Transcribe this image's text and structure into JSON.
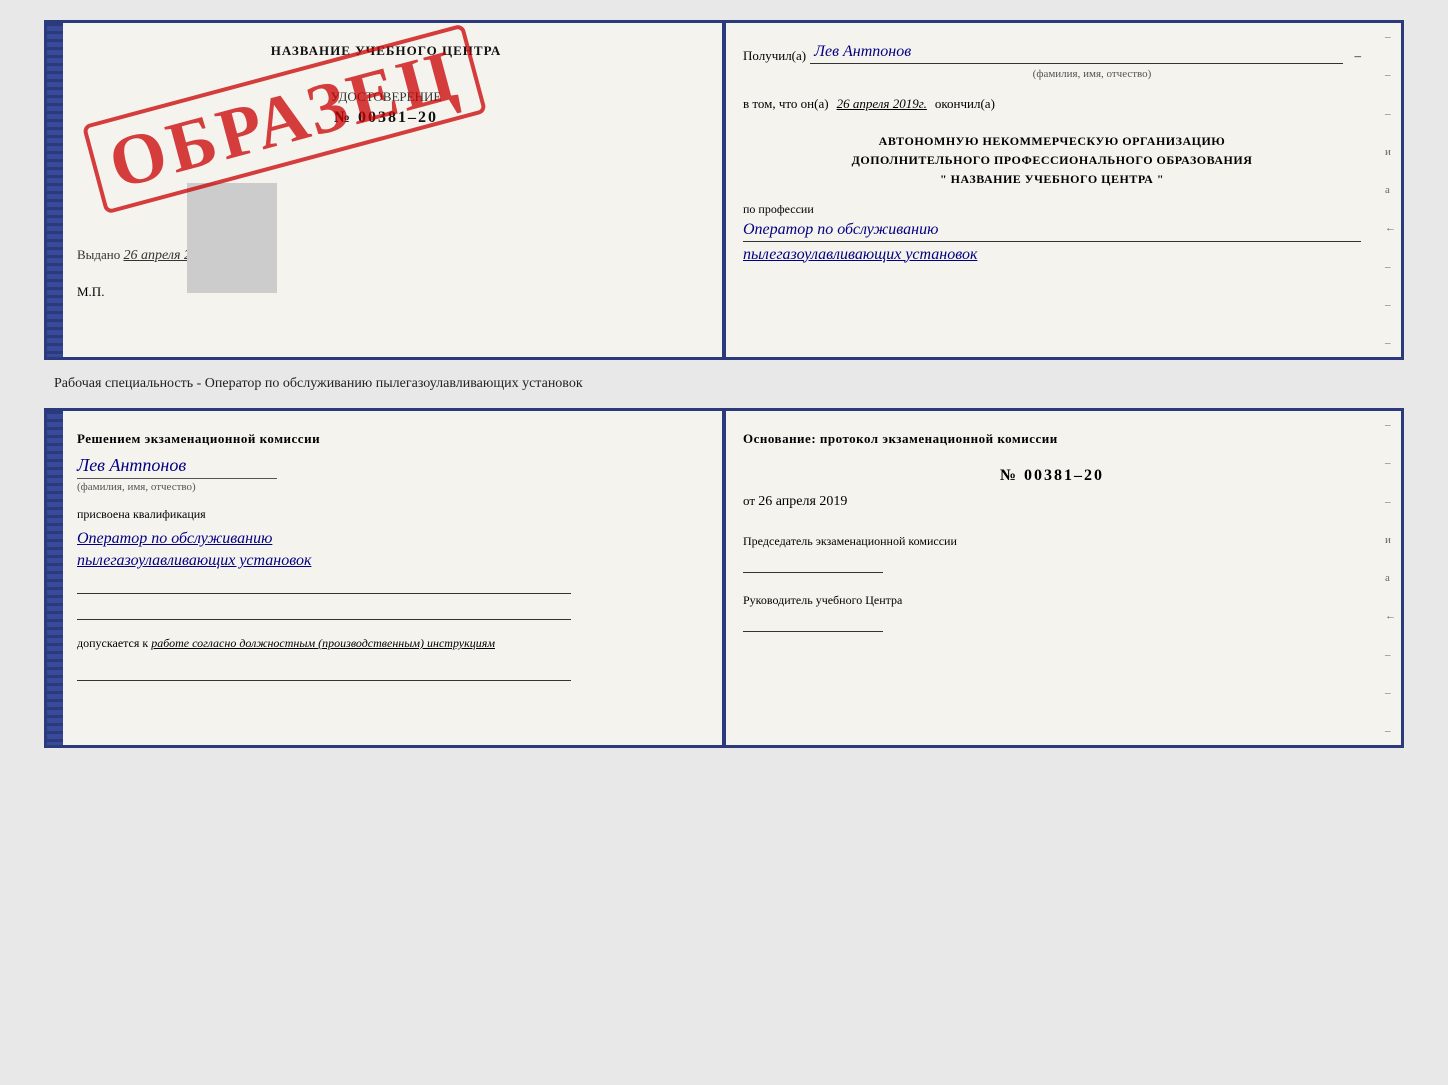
{
  "page": {
    "background": "#e8e8e8"
  },
  "top_cert": {
    "left": {
      "title": "НАЗВАНИЕ УЧЕБНОГО ЦЕНТРА",
      "stamp": "ОБРАЗЕЦ",
      "doc_label": "УДОСТОВЕРЕНИЕ",
      "doc_number_prefix": "№",
      "doc_number": "00381–20",
      "issued_label": "Выдано",
      "issued_date": "26 апреля 2019",
      "mp_label": "М.П."
    },
    "right": {
      "received_label": "Получил(а)",
      "received_name": "Лев Антпонов",
      "fio_subtitle": "(фамилия, имя, отчество)",
      "in_that_label": "в том, что он(а)",
      "in_that_date": "26 апреля 2019г.",
      "completed_label": "окончил(а)",
      "org_line1": "АВТОНОМНУЮ НЕКОММЕРЧЕСКУЮ ОРГАНИЗАЦИЮ",
      "org_line2": "ДОПОЛНИТЕЛЬНОГО ПРОФЕССИОНАЛЬНОГО ОБРАЗОВАНИЯ",
      "org_name_open": "\"",
      "org_name": "НАЗВАНИЕ УЧЕБНОГО ЦЕНТРА",
      "org_name_close": "\"",
      "profession_label": "по профессии",
      "profession_line1": "Оператор по обслуживанию",
      "profession_line2": "пылегазоулавливающих установок",
      "side_chars": [
        "–",
        "–",
        "–",
        "и",
        "а",
        "←",
        "–",
        "–",
        "–"
      ]
    }
  },
  "between_text": "Рабочая специальность - Оператор по обслуживанию пылегазоулавливающих установок",
  "bottom_cert": {
    "left": {
      "decision_text": "Решением экзаменационной комиссии",
      "person_name": "Лев Антпонов",
      "fio_subtitle": "(фамилия, имя, отчество)",
      "assigned_label": "присвоена квалификация",
      "qual_line1": "Оператор по обслуживанию",
      "qual_line2": "пылегазоулавливающих установок",
      "allowed_label": "допускается к",
      "allowed_value": "работе согласно должностным (производственным) инструкциям"
    },
    "right": {
      "basis_label": "Основание: протокол экзаменационной комиссии",
      "protocol_number_prefix": "№",
      "protocol_number": "00381–20",
      "protocol_date_prefix": "от",
      "protocol_date": "26 апреля 2019",
      "chairman_label": "Председатель экзаменационной комиссии",
      "director_label": "Руководитель учебного Центра",
      "side_chars": [
        "–",
        "–",
        "–",
        "и",
        "а",
        "←",
        "–",
        "–",
        "–"
      ]
    }
  }
}
